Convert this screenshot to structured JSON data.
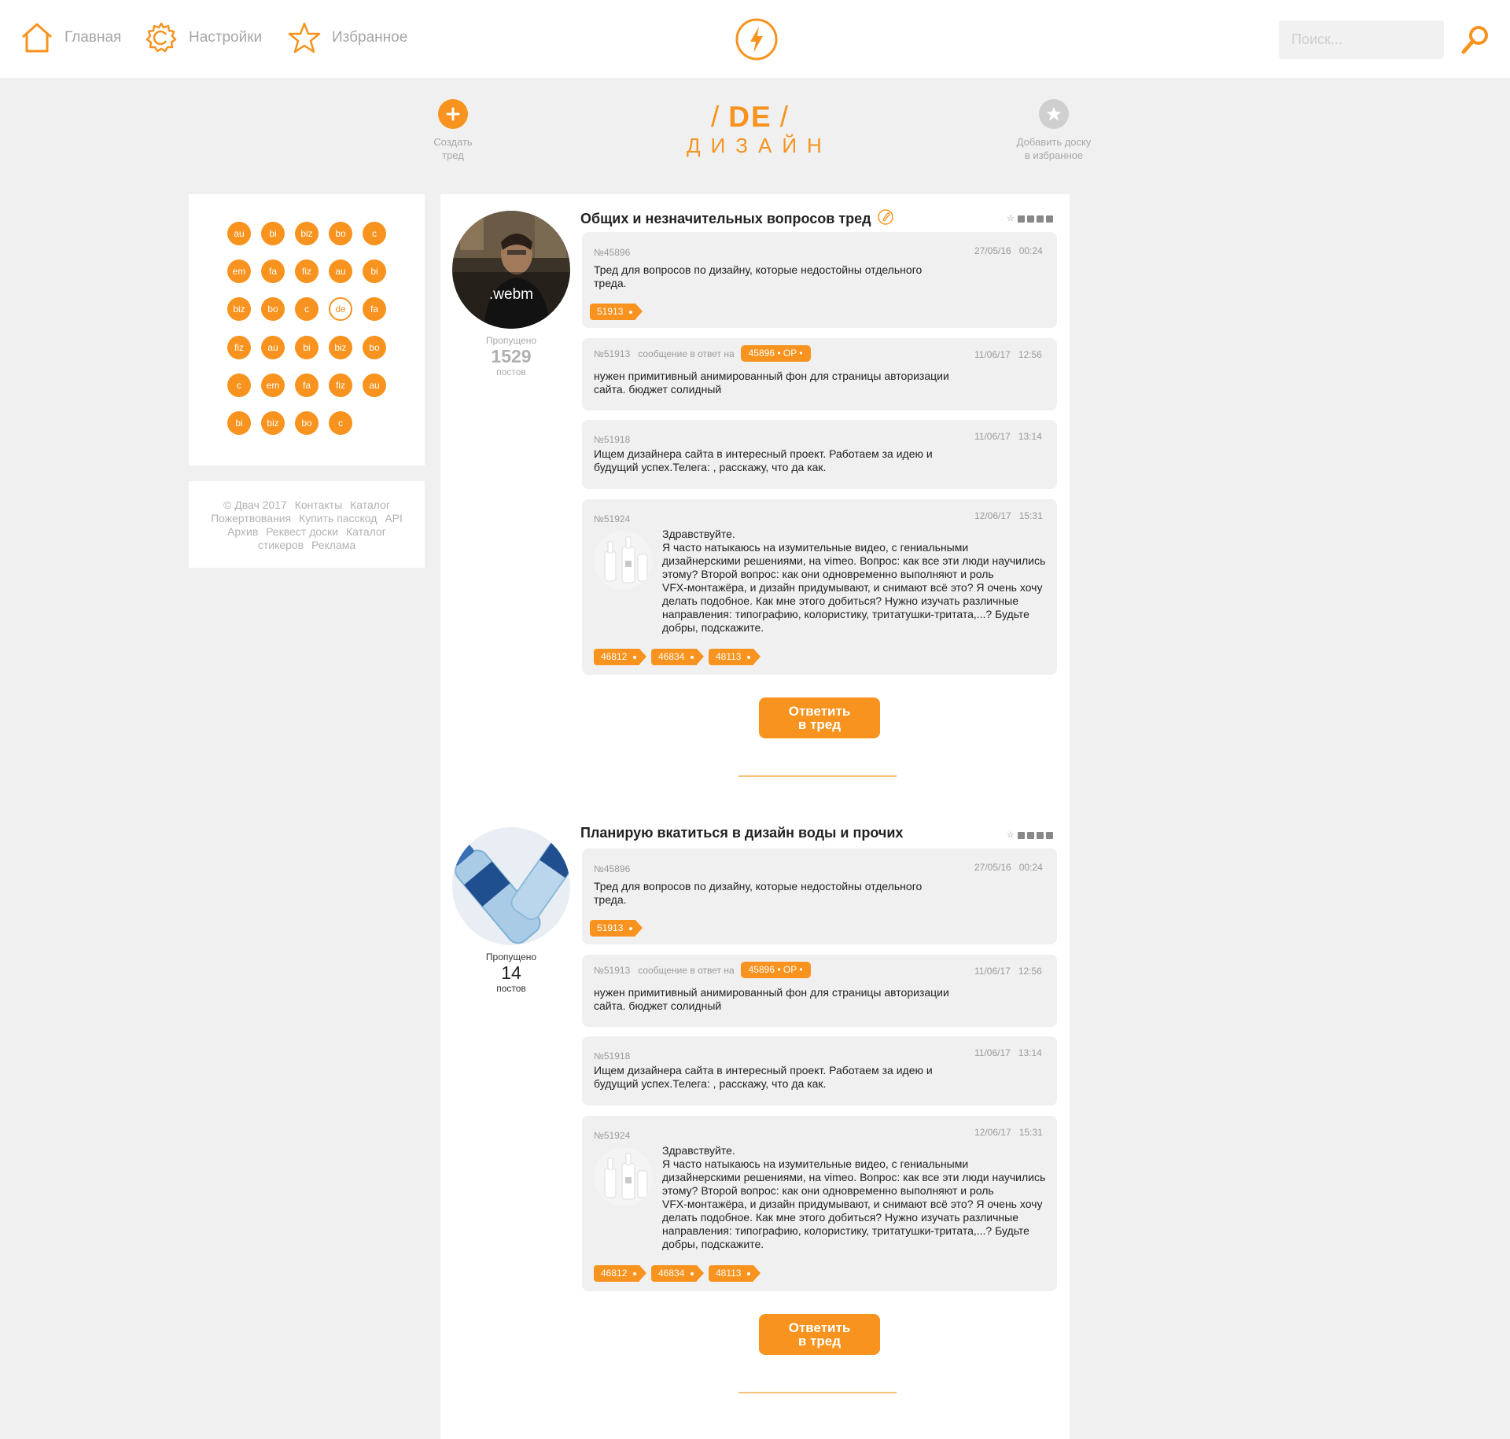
{
  "nav": {
    "home_label": "Главная",
    "settings_label": "Настройки",
    "favorites_label": "Избранное",
    "search_placeholder": "Поиск..."
  },
  "colors": {
    "accent": "#f7931e",
    "panel": "#ffffff",
    "background": "#f0f0f0",
    "post_bg": "#f0f0f0"
  },
  "board": {
    "code": "DE",
    "name": "ДИЗАЙН",
    "create_label_1": "Создать",
    "create_label_2": "тред",
    "addfav_label_1": "Добавить доску",
    "addfav_label_2": "в избранное"
  },
  "board_list": [
    [
      "au",
      "bi",
      "biz",
      "bo",
      "c"
    ],
    [
      "em",
      "fa",
      "fiz",
      "au",
      "bi"
    ],
    [
      "biz",
      "bo",
      "c",
      "de",
      "fa"
    ],
    [
      "fiz",
      "au",
      "bi",
      "biz",
      "bo"
    ],
    [
      "c",
      "em",
      "fa",
      "fiz",
      "au"
    ],
    [
      "bi",
      "biz",
      "bo",
      "c"
    ]
  ],
  "active_board": "de",
  "footer": {
    "lines": [
      [
        "© Двач 2017",
        "Контакты",
        "Каталог"
      ],
      [
        "Пожертвования",
        "Купить пасскод",
        "API"
      ],
      [
        "Архив",
        "Реквест доски",
        "Каталог"
      ],
      [
        "стикеров",
        "Реклама"
      ]
    ]
  },
  "threads": [
    {
      "title": "Общих и незначительных вопросов тред",
      "image_label": ".webm",
      "skipped_label": "Пропущено",
      "skipped_count": "1529",
      "skipped_unit": "постов",
      "reply_label_1": "Ответить",
      "reply_label_2": "в тред",
      "posts": [
        {
          "num": "№45896",
          "date": "27/05/16   00:24",
          "text_1": "Тред для вопросов по дизайну, которые недостойны отдельного",
          "text_2": "треда.",
          "tags": [
            "51913"
          ]
        },
        {
          "num": "№51913",
          "reply_text": "сообщение в ответ на",
          "reply_tag": "45896 • OP •",
          "date": "11/06/17   12:56",
          "text_1": "нужен примитивный анимированный фон для страницы авторизации",
          "text_2": "сайта. бюджет солидный"
        },
        {
          "num": "№51918",
          "date": "11/06/17   13:14",
          "text_1": "Ищем дизайнера сайта в интересный проект. Работаем за идею и",
          "text_2": "будущий успех.Телега: , расскажу, что да как."
        },
        {
          "num": "№51924",
          "date": "12/06/17   15:31",
          "lines": [
            "Здравствуйте.",
            "Я часто натыкаюсь на изумительные видео, с гениальными",
            "дизайнерскими решениями, на vimeo. Вопрос: как все эти люди научились",
            "этому? Второй вопрос: как они одновременно выполняют и роль",
            "VFX-монтажёра, и дизайн придумывают, и снимают всё это? Я очень хочу",
            "делать подобное. Как мне этого добиться? Нужно изучать различные",
            "направления: типографию, колористику, тритатушки-тритата,...? Будьте",
            "добры, подскажите."
          ],
          "tags": [
            "46812",
            "46834",
            "48113"
          ]
        }
      ]
    },
    {
      "title": "Планирую вкатиться в дизайн воды и прочих",
      "skipped_label": "Пропущено",
      "skipped_count": "14",
      "skipped_unit": "постов",
      "reply_label_1": "Ответить",
      "reply_label_2": "в тред",
      "posts": [
        {
          "num": "№45896",
          "date": "27/05/16   00:24",
          "text_1": "Тред для вопросов по дизайну, которые недостойны отдельного",
          "text_2": "треда.",
          "tags": [
            "51913"
          ]
        },
        {
          "num": "№51913",
          "reply_text": "сообщение в ответ на",
          "reply_tag": "45896 • OP •",
          "date": "11/06/17   12:56",
          "text_1": "нужен примитивный анимированный фон для страницы авторизации",
          "text_2": "сайта. бюджет солидный"
        },
        {
          "num": "№51918",
          "date": "11/06/17   13:14",
          "text_1": "Ищем дизайнера сайта в интересный проект. Работаем за идею и",
          "text_2": "будущий успех.Телега: , расскажу, что да как."
        },
        {
          "num": "№51924",
          "date": "12/06/17   15:31",
          "lines": [
            "Здравствуйте.",
            "Я часто натыкаюсь на изумительные видео, с гениальными",
            "дизайнерскими решениями, на vimeo. Вопрос: как все эти люди научились",
            "этому? Второй вопрос: как они одновременно выполняют и роль",
            "VFX-монтажёра, и дизайн придумывают, и снимают всё это? Я очень хочу",
            "делать подобное. Как мне этого добиться? Нужно изучать различные",
            "направления: типографию, колористику, тритатушки-тритата,...? Будьте",
            "добры, подскажите."
          ],
          "tags": [
            "46812",
            "46834",
            "48113"
          ]
        }
      ]
    }
  ]
}
